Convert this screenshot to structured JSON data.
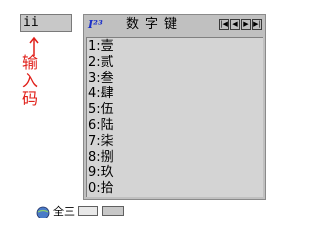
{
  "input": {
    "code_value": "ii",
    "label_chars": [
      "输",
      "入",
      "码"
    ]
  },
  "candidates": {
    "logo": "I²³",
    "title": "数字键",
    "page_buttons": [
      "|◀",
      "◀",
      "▶",
      "▶|"
    ],
    "items": [
      "1:壹",
      "2:贰",
      "3:叁",
      "4:肆",
      "5:伍",
      "6:陆",
      "7:柒",
      "8:捌",
      "9:玖",
      "0:拾"
    ]
  },
  "status": {
    "text": "全三"
  },
  "colors": {
    "label_red": "#e0201a",
    "logo_blue": "#1a2fc8",
    "panel_gray": "#c0c0c0"
  }
}
